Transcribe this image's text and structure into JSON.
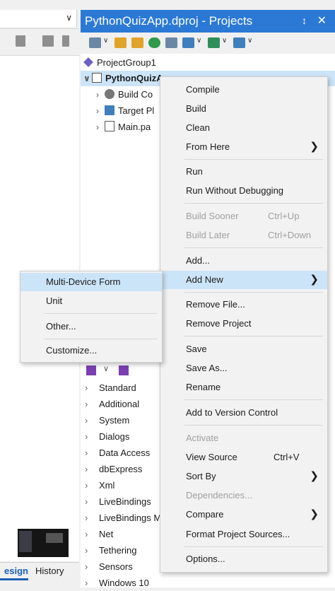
{
  "projects": {
    "title": "PythonQuizApp.dproj - Projects",
    "pin_glyph": "↕",
    "close_glyph": "✕",
    "tree": [
      {
        "label": "ProjectGroup1",
        "arrow": "",
        "icon": "project-group-icon"
      },
      {
        "label": "PythonQuizApp.exe",
        "arrow": "∨",
        "icon": "exe-project-icon"
      },
      {
        "label": "Build Co",
        "arrow": "›",
        "icon": "build-config-icon"
      },
      {
        "label": "Target Pl",
        "arrow": "›",
        "icon": "target-platform-icon"
      },
      {
        "label": "Main.pa",
        "arrow": "›",
        "icon": "unit-file-icon"
      }
    ]
  },
  "palette": [
    "Standard",
    "Additional",
    "System",
    "Dialogs",
    "Data Access",
    "dbExpress",
    "Xml",
    "LiveBindings",
    "LiveBindings M",
    "Net",
    "Tethering",
    "Sensors",
    "Windows 10"
  ],
  "left": {
    "tab_design": "esign",
    "tab_history": "History"
  },
  "menu": {
    "items": [
      {
        "label": "Compile"
      },
      {
        "label": "Build"
      },
      {
        "label": "Clean"
      },
      {
        "label": "From Here",
        "submenu": true
      },
      {
        "label": "Run"
      },
      {
        "label": "Run Without Debugging"
      },
      {
        "label": "Build Sooner",
        "shortcut": "Ctrl+Up",
        "disabled": true
      },
      {
        "label": "Build Later",
        "shortcut": "Ctrl+Down",
        "disabled": true
      },
      {
        "label": "Add..."
      },
      {
        "label": "Add New",
        "submenu": true,
        "highlighted": true
      },
      {
        "label": "Remove File..."
      },
      {
        "label": "Remove Project"
      },
      {
        "label": "Save"
      },
      {
        "label": "Save As..."
      },
      {
        "label": "Rename"
      },
      {
        "label": "Add to Version Control"
      },
      {
        "label": "Activate",
        "disabled": true
      },
      {
        "label": "View Source",
        "shortcut": "Ctrl+V"
      },
      {
        "label": "Sort By",
        "submenu": true
      },
      {
        "label": "Dependencies...",
        "disabled": true
      },
      {
        "label": "Compare",
        "submenu": true
      },
      {
        "label": "Format Project Sources..."
      },
      {
        "label": "Options..."
      }
    ],
    "submenu_glyph": "❯"
  },
  "submenu": {
    "items": [
      {
        "label": "Multi-Device Form",
        "highlighted": true
      },
      {
        "label": "Unit"
      },
      {
        "label": "Other..."
      },
      {
        "label": "Customize..."
      }
    ]
  },
  "colors": {
    "title_bar": "#2b79d4",
    "highlight": "#cce4f7",
    "disabled_text": "#a0a0a0"
  }
}
